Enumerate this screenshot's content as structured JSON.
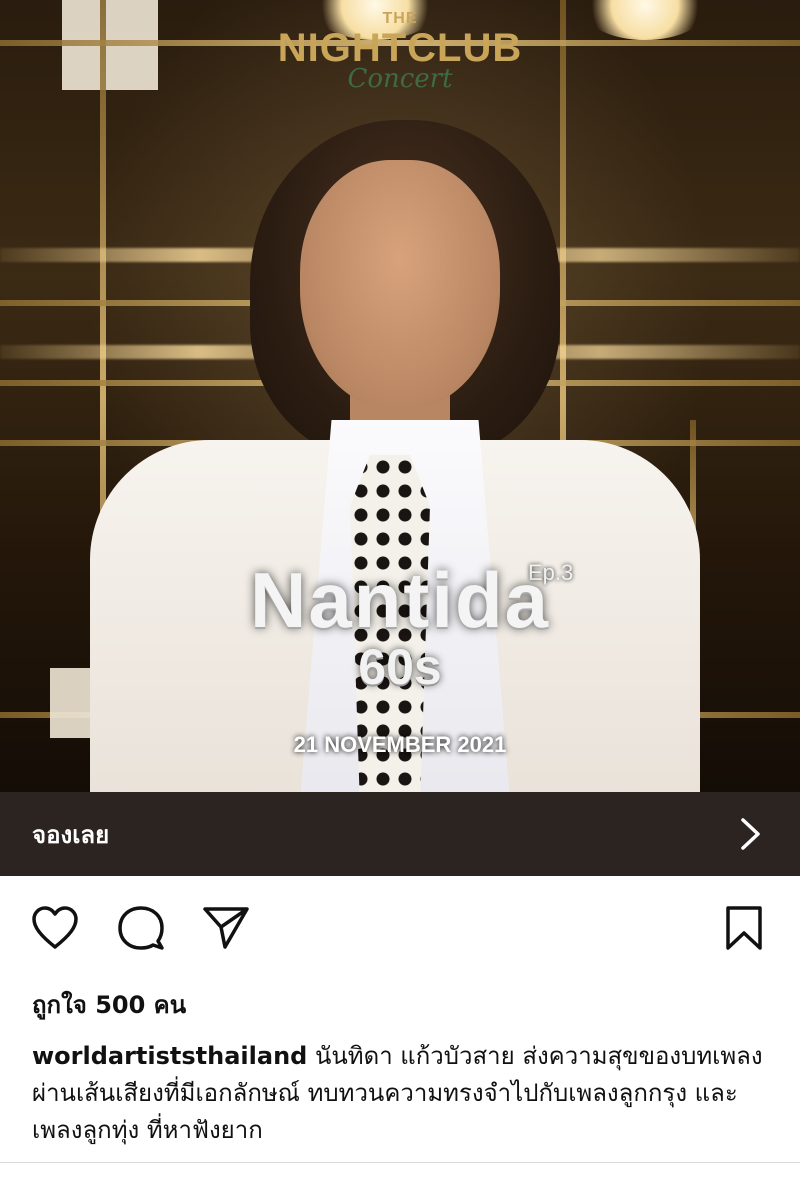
{
  "post_image": {
    "logo": {
      "top": "THE",
      "main": "NIGHTCLUB",
      "script": "Concert"
    },
    "episode": "Ep.3",
    "artist_name": "Nantida",
    "decade": "60s",
    "date": "21 NOVEMBER 2021"
  },
  "cta": {
    "label": "จองเลย",
    "icon": "chevron-right-icon"
  },
  "actions": {
    "like_icon": "heart-icon",
    "comment_icon": "comment-icon",
    "share_icon": "send-icon",
    "save_icon": "bookmark-icon"
  },
  "likes_text": "ถูกใจ 500 คน",
  "caption": {
    "username": "worldartiststhailand",
    "text": "นันทิดา แก้วบัวสาย ส่งความสุขของบทเพลง ผ่านเส้นเสียงที่มีเอกลักษณ์ ทบทวนความทรงจำไปกับเพลงลูกกรุง และเพลงลูกทุ่ง ที่หาฟังยาก"
  },
  "colors": {
    "cta_background": "#2c2421",
    "logo_gold": "#c9a55a",
    "logo_green": "#3e6b45"
  }
}
